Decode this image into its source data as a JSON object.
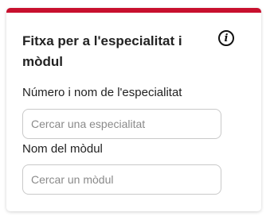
{
  "card": {
    "title": "Fitxa per a l'especialitat i mòdul",
    "info_icon_label": "i",
    "accent_color": "#c8102e"
  },
  "specialty": {
    "label": "Número i nom de l'especialitat",
    "placeholder": "Cercar una especialitat",
    "value": ""
  },
  "module": {
    "label": "Nom del mòdul",
    "placeholder": "Cercar un mòdul",
    "value": ""
  }
}
